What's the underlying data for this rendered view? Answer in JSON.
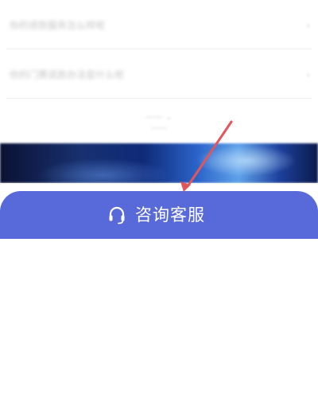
{
  "faq_items": [
    {
      "question": "你的退款服务怎么样呢"
    },
    {
      "question": "你的门票退款办法是什么呢"
    }
  ],
  "colors": {
    "button_bg": "#5869d9",
    "button_text": "#ffffff",
    "annotation_arrow": "#e0565a"
  },
  "contact_button": {
    "label": "咨询客服",
    "icon": "headset-icon"
  }
}
